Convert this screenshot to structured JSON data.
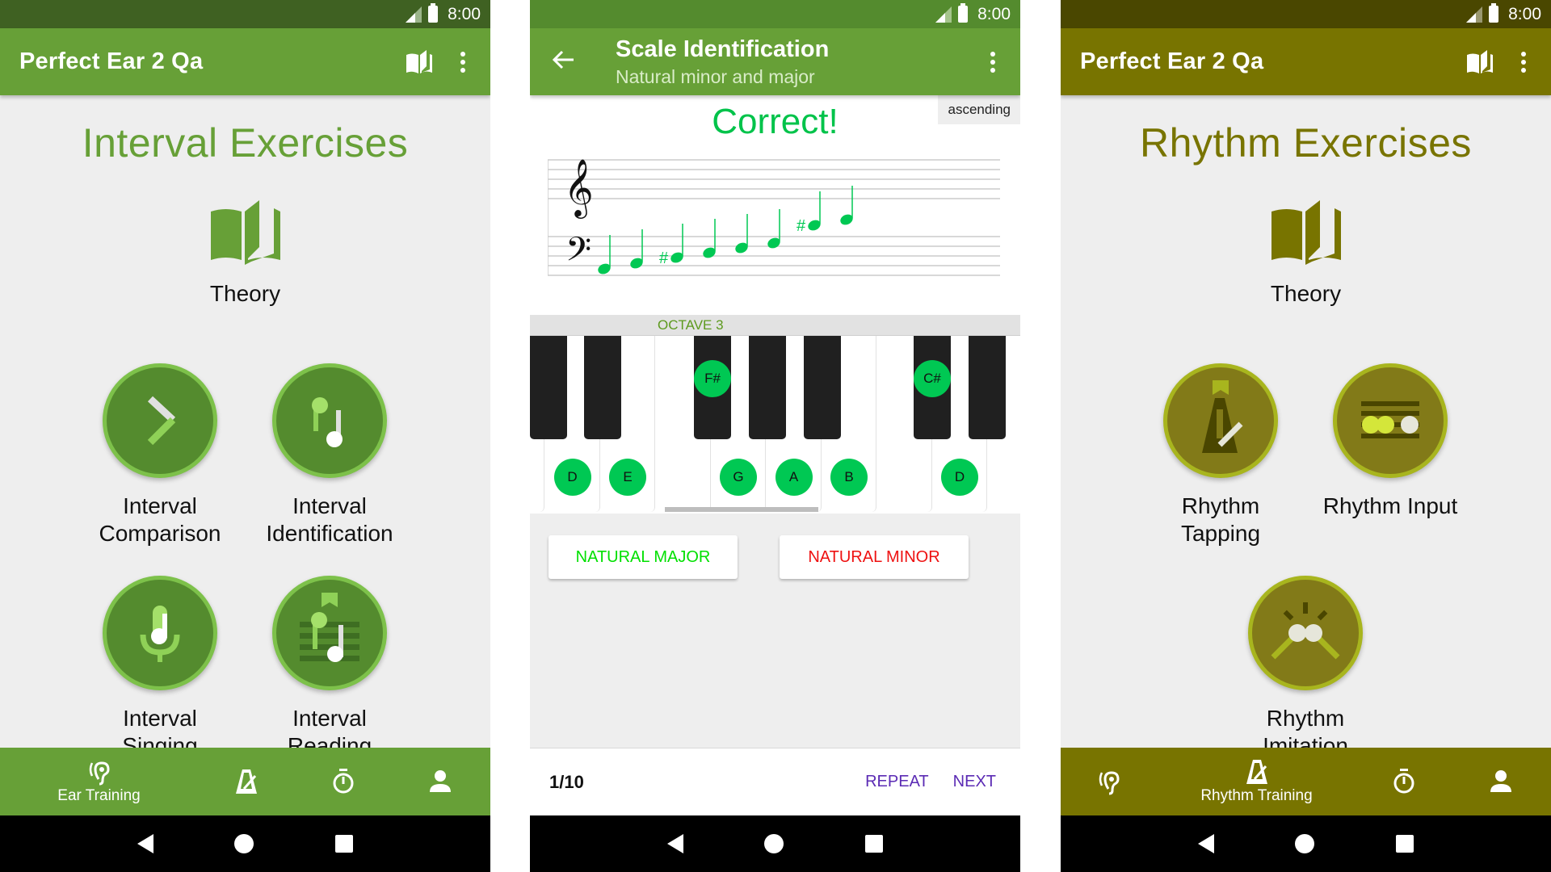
{
  "status_bar": {
    "time": "8:00"
  },
  "left": {
    "app_title": "Perfect Ear 2 Qa",
    "section_title": "Interval Exercises",
    "theory_label": "Theory",
    "exercises": [
      {
        "line1": "Interval",
        "line2": "Comparison",
        "icon": "chevron-right-icon"
      },
      {
        "line1": "Interval",
        "line2": "Identification",
        "icon": "music-notes-icon"
      },
      {
        "line1": "Interval",
        "line2": "Singing",
        "icon": "microphone-note-icon"
      },
      {
        "line1": "Interval",
        "line2": "Reading",
        "icon": "sheet-music-icon"
      }
    ],
    "bottom_nav": [
      {
        "label": "Ear Training",
        "icon": "ear-icon",
        "active": true
      },
      {
        "label": "",
        "icon": "metronome-icon",
        "active": false
      },
      {
        "label": "",
        "icon": "stopwatch-icon",
        "active": false
      },
      {
        "label": "",
        "icon": "person-icon",
        "active": false
      }
    ],
    "colors": {
      "primary": "#67a037",
      "status": "#3f6122"
    }
  },
  "middle": {
    "title": "Scale Identification",
    "subtitle": "Natural minor and major",
    "direction": "ascending",
    "result": "Correct!",
    "staff_notes": [
      "D",
      "E",
      "F#",
      "G",
      "A",
      "B",
      "C#",
      "D"
    ],
    "octave_label": "OCTAVE 3",
    "piano": {
      "white_keys": [
        "C",
        "D",
        "E",
        "F",
        "G",
        "A",
        "B",
        "C",
        "D",
        "E"
      ],
      "highlighted_white": [
        "D",
        "E",
        "G",
        "A",
        "B",
        "D"
      ],
      "highlighted_black": [
        "F#",
        "C#"
      ]
    },
    "answers": [
      {
        "label": "NATURAL MAJOR",
        "color": "#00e000"
      },
      {
        "label": "NATURAL MINOR",
        "color": "#ee1111"
      }
    ],
    "progress": "1/10",
    "repeat_label": "REPEAT",
    "next_label": "NEXT"
  },
  "right": {
    "app_title": "Perfect Ear 2 Qa",
    "section_title": "Rhythm Exercises",
    "theory_label": "Theory",
    "exercises": [
      {
        "line1": "Rhythm",
        "line2": "Tapping",
        "icon": "metronome-icon"
      },
      {
        "line1": "Rhythm Input",
        "line2": "",
        "icon": "rhythm-input-icon"
      },
      {
        "line1": "Rhythm",
        "line2": "Imitation",
        "icon": "drumsticks-icon"
      }
    ],
    "bottom_nav": [
      {
        "label": "",
        "icon": "ear-icon",
        "active": false
      },
      {
        "label": "Rhythm Training",
        "icon": "metronome-icon",
        "active": true
      },
      {
        "label": "",
        "icon": "stopwatch-icon",
        "active": false
      },
      {
        "label": "",
        "icon": "person-icon",
        "active": false
      }
    ],
    "colors": {
      "primary": "#787400",
      "status": "#4a4700"
    }
  }
}
